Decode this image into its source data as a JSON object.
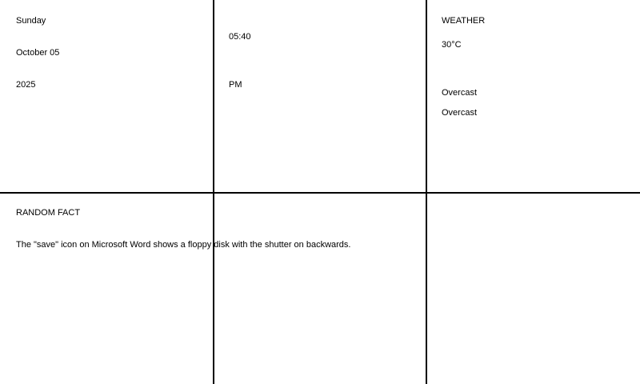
{
  "date": {
    "weekday": "Sunday",
    "month_day": "October 05",
    "year": "2025"
  },
  "time": {
    "clock": "05:40",
    "meridiem": "PM"
  },
  "weather": {
    "heading": "WEATHER",
    "temperature": "30°C",
    "condition": "Overcast",
    "description": "Overcast"
  },
  "fact": {
    "heading": "RANDOM FACT",
    "text": "The \"save\" icon on Microsoft Word shows a floppy disk with the shutter on backwards."
  }
}
